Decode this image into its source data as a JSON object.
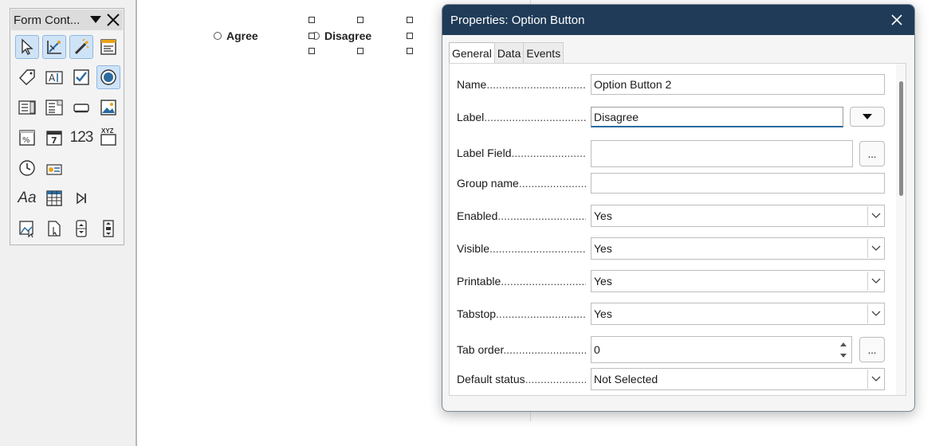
{
  "toolbar": {
    "title": "Form Cont...",
    "icons": [
      "select-icon",
      "design-mode-icon",
      "control-wizards-icon",
      "form-design-icon",
      "label-icon",
      "text-box-icon",
      "check-box-icon",
      "option-button-icon",
      "list-box-icon",
      "combo-box-icon",
      "push-button-icon",
      "image-button-icon",
      "formatted-field-icon",
      "date-field-icon",
      "numerical-field-icon",
      "pattern-field-icon",
      "time-field-icon",
      "currency-field-icon",
      "font-field-icon",
      "table-control-icon",
      "navigation-bar-icon",
      "image-control-icon",
      "file-selection-icon",
      "spin-button-icon",
      "scrollbar-icon"
    ],
    "numeric_glyph": "123",
    "font_glyph": "Aa",
    "pattern_glyph": "XYZ"
  },
  "document": {
    "option_agree": "Agree",
    "option_disagree": "Disagree"
  },
  "dialog": {
    "title": "Properties: Option Button",
    "tabs": [
      "General",
      "Data",
      "Events"
    ],
    "active_tab": "General",
    "rows": {
      "name": {
        "label": "Name",
        "value": "Option Button 2"
      },
      "label": {
        "label": "Label",
        "value": "Disagree"
      },
      "label_field": {
        "label": "Label Field",
        "value": "",
        "button": "..."
      },
      "group_name": {
        "label": "Group name",
        "value": ""
      },
      "enabled": {
        "label": "Enabled",
        "value": "Yes"
      },
      "visible": {
        "label": "Visible",
        "value": "Yes"
      },
      "printable": {
        "label": "Printable",
        "value": "Yes"
      },
      "tabstop": {
        "label": "Tabstop",
        "value": "Yes"
      },
      "tab_order": {
        "label": "Tab order",
        "value": "0",
        "button": "..."
      },
      "default_status": {
        "label": "Default status",
        "value": "Not Selected"
      }
    }
  },
  "colors": {
    "titlebar": "#1f3b57",
    "active_tool": "#cfe3f7",
    "focus_underline": "#2a6aa0"
  }
}
